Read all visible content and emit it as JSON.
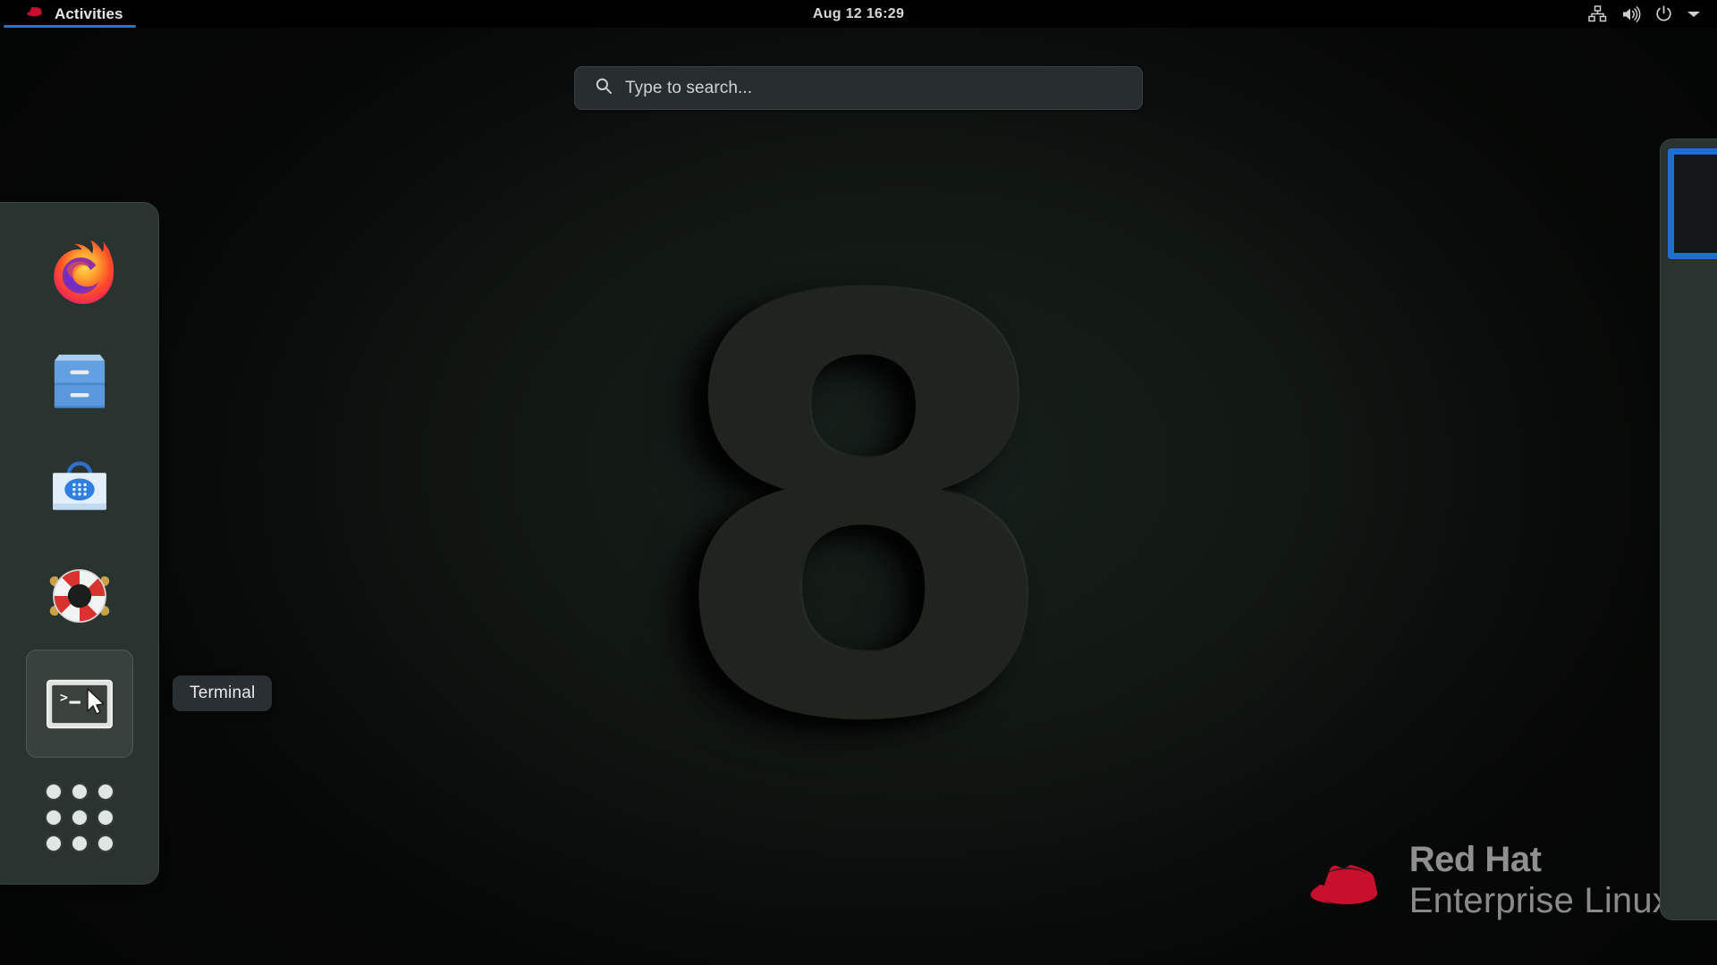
{
  "topbar": {
    "activities_label": "Activities",
    "activities_icon": "redhat-logo-icon",
    "clock": "Aug 12  16:29",
    "status_icons": [
      {
        "name": "wired-network-icon",
        "label": "Wired Network"
      },
      {
        "name": "volume-icon",
        "label": "Volume"
      },
      {
        "name": "power-icon",
        "label": "Power"
      },
      {
        "name": "chevron-down-icon",
        "label": "System Menu"
      }
    ]
  },
  "search": {
    "placeholder": "Type to search...",
    "value": "",
    "icon": "search-icon"
  },
  "dock": {
    "items": [
      {
        "name": "firefox",
        "label": "Firefox",
        "icon": "firefox-icon",
        "active": false
      },
      {
        "name": "files",
        "label": "Files",
        "icon": "files-cabinet-icon",
        "active": false
      },
      {
        "name": "software",
        "label": "Software",
        "icon": "software-bag-icon",
        "active": false
      },
      {
        "name": "help",
        "label": "Help",
        "icon": "help-lifering-icon",
        "active": false
      },
      {
        "name": "terminal",
        "label": "Terminal",
        "icon": "terminal-icon",
        "active": true
      }
    ],
    "show_apps_label": "Show Applications",
    "show_apps_icon": "grid-dots-icon"
  },
  "tooltip": {
    "text": "Terminal"
  },
  "workspaces": {
    "active_index": 0,
    "active_color": "#1f6fd0"
  },
  "wallpaper": {
    "watermark": "8"
  },
  "branding": {
    "line1": "Red Hat",
    "line2": "Enterprise Linux",
    "logo_icon": "red-hat-fedora-icon",
    "logo_color": "#c8102e"
  },
  "colors": {
    "topbar_bg": "#000000",
    "dock_bg": "#29332f",
    "search_bg": "#282e30",
    "accent_blue": "#2a74c9",
    "tooltip_bg": "#2a2f33"
  }
}
